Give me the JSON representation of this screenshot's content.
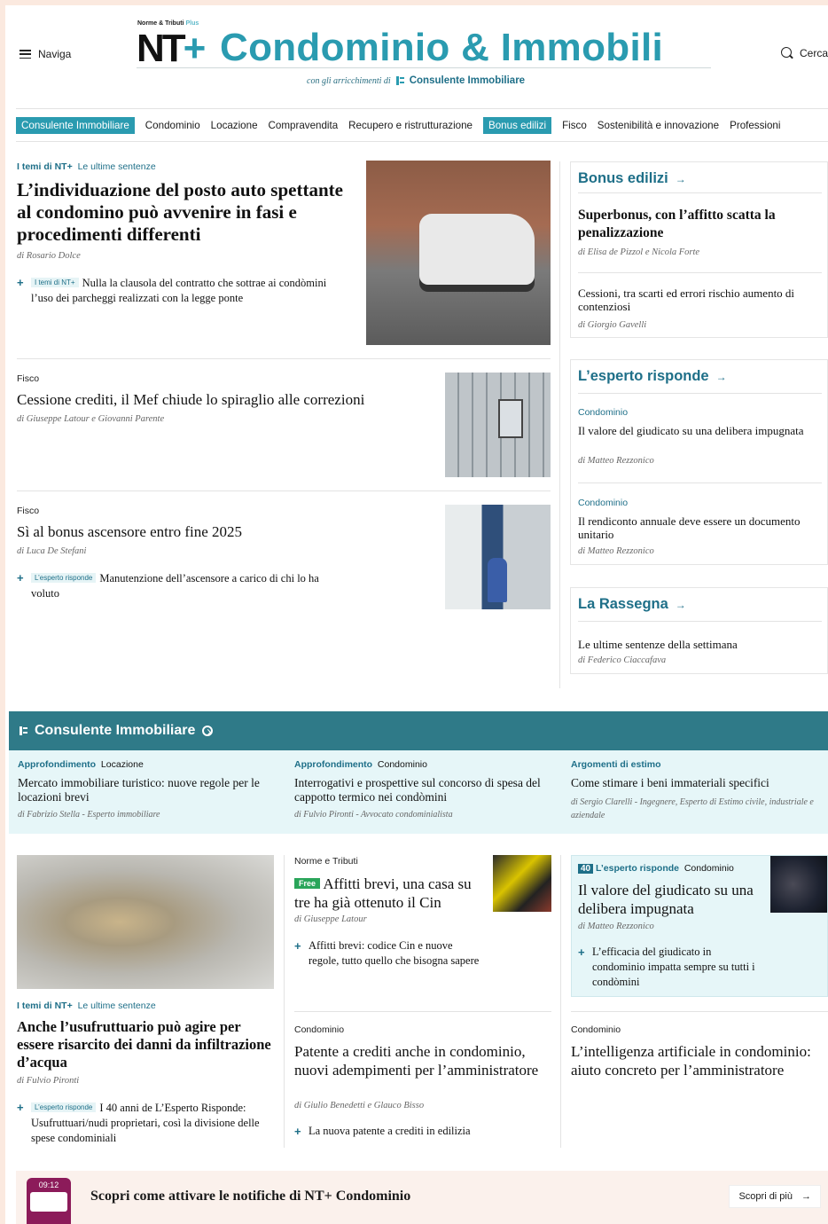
{
  "header": {
    "naviga": "Naviga",
    "cerca": "Cerca",
    "logo_top": "Norme & Tributi",
    "logo_top_plus": "Plus",
    "logo_nt": "NT",
    "logo_plus": "+",
    "logo_title": "Condominio & Immobili",
    "logo_sub_prefix": "con gli arricchimenti di",
    "logo_sub_brand": "Consulente Immobiliare"
  },
  "nav": {
    "items": [
      "Consulente Immobiliare",
      "Condominio",
      "Locazione",
      "Compravendita",
      "Recupero e ristrutturazione",
      "Bonus edilizi",
      "Fisco",
      "Sostenibilità e innovazione",
      "Professioni"
    ]
  },
  "main": {
    "a1": {
      "kicker": "I temi di NT+",
      "kicker_sub": "Le ultime sentenze",
      "title": "L’individuazione del posto auto spettante al condomino può avvenire in fasi e procedimenti differenti",
      "byline": "di Rosario Dolce",
      "rel_tag": "I temi di NT+",
      "rel_text": "Nulla la clausola del contratto che sottrae ai condòmini l’uso dei parcheggi realizzati con la legge ponte"
    },
    "a2": {
      "kicker": "Fisco",
      "title": "Cessione crediti, il Mef chiude lo spiraglio alle correzioni",
      "byline": "di Giuseppe Latour e Giovanni Parente"
    },
    "a3": {
      "kicker": "Fisco",
      "title": "Sì al bonus ascensore entro fine 2025",
      "byline": "di Luca De Stefani",
      "rel_tag": "L’esperto risponde",
      "rel_text": "Manutenzione dell’ascensore a carico di chi lo ha voluto"
    }
  },
  "sidebar": {
    "bonus": {
      "head": "Bonus edilizi",
      "i1_title": "Superbonus, con l’affitto scatta la penalizzazione",
      "i1_by": "di Elisa de Pizzol e Nicola Forte",
      "i2_title": "Cessioni, tra scarti ed errori rischio aumento di contenziosi",
      "i2_by": "di Giorgio Gavelli"
    },
    "esperto": {
      "head": "L’esperto risponde",
      "i1_kick": "Condominio",
      "i1_title": "Il valore del giudicato su una delibera impugnata",
      "i1_by": "di Matteo Rezzonico",
      "i2_kick": "Condominio",
      "i2_title": "Il rendiconto annuale deve essere un documento unitario",
      "i2_by": "di Matteo Rezzonico"
    },
    "rassegna": {
      "head": "La Rassegna",
      "i1_title": "Le ultime sentenze della settimana",
      "i1_by": "di Federico Ciaccafava"
    }
  },
  "consulente": {
    "head": "Consulente Immobiliare",
    "c1_kick": "Approfondimento",
    "c1_kick_sub": "Locazione",
    "c1_title": "Mercato immobiliare turistico: nuove regole per le locazioni brevi",
    "c1_by": "di Fabrizio Stella - Esperto immobiliare",
    "c2_kick": "Approfondimento",
    "c2_kick_sub": "Condominio",
    "c2_title": "Interrogativi e prospettive sul concorso di spesa del cappotto termico nei condòmini",
    "c2_by": "di Fulvio Pironti - Avvocato condominialista",
    "c3_kick": "Argomenti di estimo",
    "c3_title": "Come stimare i beni immateriali specifici",
    "c3_by": "di Sergio Clarelli - Ingegnere, Esperto di Estimo civile, industriale e aziendale"
  },
  "lower": {
    "b1": {
      "kicker": "I temi di NT+",
      "kicker_sub": "Le ultime sentenze",
      "title": "Anche l’usufruttuario può agire per essere risarcito dei danni da infiltrazione d’acqua",
      "byline": "di Fulvio Pironti",
      "rel_tag": "L’esperto risponde",
      "rel_text": "I 40 anni de L’Esperto Risponde: Usufruttuari/nudi proprietari, così la divisione delle spese condominiali"
    },
    "b2": {
      "kicker": "Norme e Tributi",
      "badge": "Free",
      "title": "Affitti brevi, una casa su tre ha già ottenuto il Cin",
      "byline": "di Giuseppe Latour",
      "rel_text": "Affitti brevi: codice Cin e nuove regole, tutto quello che bisogna sapere"
    },
    "b3": {
      "badge": "40",
      "kicker": "L’esperto risponde",
      "kicker_sub": "Condominio",
      "title": "Il valore del giudicato su una delibera impugnata",
      "byline": "di Matteo Rezzonico",
      "rel_text": "L’efficacia del giudicato in condominio impatta sempre su tutti i condòmini"
    },
    "b4": {
      "kicker": "Condominio",
      "title": "Patente a crediti anche in condominio, nuovi adempimenti per l’amministratore",
      "byline": "di Giulio Benedetti e Glauco Bisso",
      "rel_text": "La nuova patente a crediti in edilizia"
    },
    "b5": {
      "kicker": "Condominio",
      "title": "L’intelligenza artificiale in condominio: aiuto concreto per l’amministratore"
    }
  },
  "notif": {
    "time": "09:12",
    "title": "Scopri come attivare le notifiche di NT+ Condominio",
    "button": "Scopri di più",
    "button_arrow": "→"
  },
  "icons": {
    "arrow": "→",
    "plus": "+"
  },
  "colors": {
    "accent": "#2a9bb0",
    "dark_accent": "#1e6f88",
    "band": "#2f7a88",
    "band_light": "#e6f6f8"
  }
}
